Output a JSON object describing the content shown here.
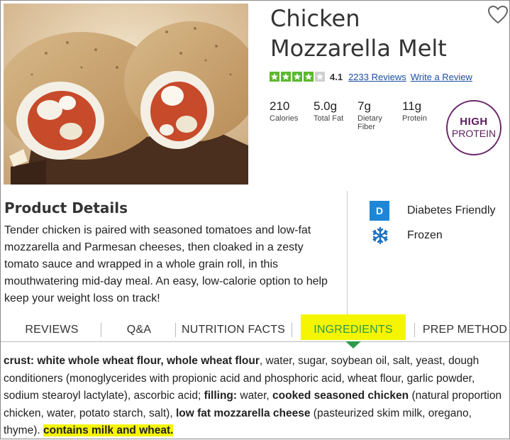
{
  "product": {
    "title": "Chicken Mozzarella Melt",
    "rating": {
      "stars": 4,
      "max_stars": 5,
      "value": "4.1",
      "reviews_link": "2233 Reviews",
      "write_link": "Write a Review"
    },
    "nutrition": [
      {
        "value": "210",
        "label": "Calories"
      },
      {
        "value": "5.0g",
        "label": "Total Fat"
      },
      {
        "value": "7g",
        "label": "Dietary Fiber"
      },
      {
        "value": "11g",
        "label": "Protein"
      }
    ],
    "badge": {
      "line1": "HIGH",
      "line2": "PROTEIN"
    }
  },
  "details": {
    "heading": "Product Details",
    "text": "Tender chicken is paired with seasoned tomatoes and low-fat mozzarella and Parmesan cheeses, then cloaked in a zesty tomato sauce and wrapped in a whole grain roll, in this mouthwatering mid-day meal. An easy, low-calorie option to help keep your weight loss on track!"
  },
  "features": [
    {
      "icon": "D",
      "icon_name": "diabetes-friendly-icon",
      "label": "Diabetes Friendly"
    },
    {
      "icon_name": "snowflake-icon",
      "label": "Frozen"
    }
  ],
  "tabs": [
    "REVIEWS",
    "Q&A",
    "NUTRITION FACTS",
    "INGREDIENTS",
    "PREP METHOD"
  ],
  "active_tab": "INGREDIENTS",
  "ingredients": {
    "crust_label": "crust:",
    "crust_bold": "white whole wheat flour, whole wheat flour",
    "crust_rest": ", water, sugar, soybean oil, salt, yeast, dough conditioners (monoglycerides with propionic acid and phosphoric acid, wheat flour, garlic powder, sodium stearoyl lactylate), ascorbic acid; ",
    "filling_label": "filling:",
    "filling_rest": " water, ",
    "chicken_bold": "cooked seasoned chicken",
    "chicken_rest": " (natural proportion chicken, water, potato starch, salt), ",
    "cheese_bold": "low fat mozzarella cheese",
    "cheese_rest": " (pasteurized skim milk, oregano, thyme). ",
    "allergen": "contains milk and wheat."
  },
  "colors": {
    "link": "#1a4fa0",
    "star_green": "#5cb82e",
    "badge_purple": "#6a2a6a",
    "highlight_yellow": "#f5f500",
    "active_tab_text": "#2e9a4d",
    "diabetes_blue": "#1d86d6"
  }
}
